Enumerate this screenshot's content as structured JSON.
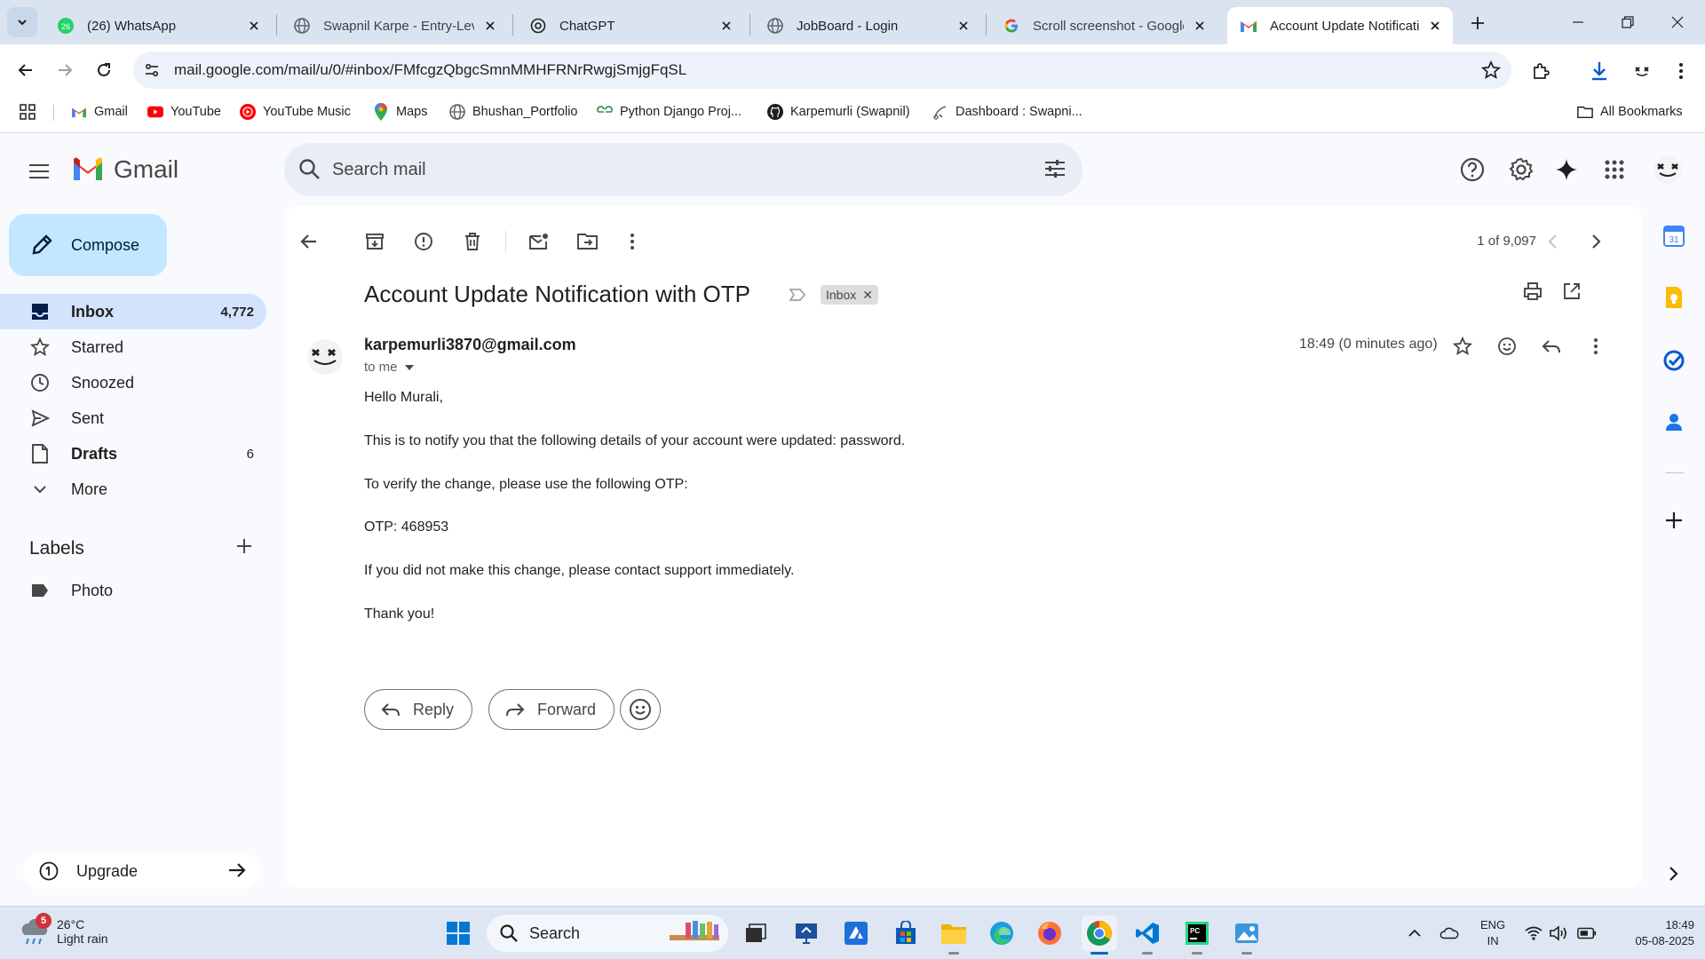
{
  "browser": {
    "tabs": [
      {
        "title": "(26) WhatsApp",
        "icon": "whatsapp-icon",
        "badge": "26"
      },
      {
        "title": "Swapnil Karpe - Entry-Leve",
        "icon": "globe-icon"
      },
      {
        "title": "ChatGPT",
        "icon": "chatgpt-icon"
      },
      {
        "title": "JobBoard - Login",
        "icon": "globe-icon"
      },
      {
        "title": "Scroll screenshot - Google",
        "icon": "google-icon"
      },
      {
        "title": "Account Update Notificati",
        "icon": "gmail-icon",
        "active": true
      }
    ],
    "url": "mail.google.com/mail/u/0/#inbox/FMfcgzQbgcSmnMMHFRNrRwgjSmjgFqSL",
    "bookmarks": [
      {
        "label": "Gmail",
        "icon": "gmail-icon"
      },
      {
        "label": "YouTube",
        "icon": "youtube-icon"
      },
      {
        "label": "YouTube Music",
        "icon": "youtube-music-icon"
      },
      {
        "label": "Maps",
        "icon": "maps-icon"
      },
      {
        "label": "Bhushan_Portfolio",
        "icon": "globe-icon"
      },
      {
        "label": "Python Django Proj...",
        "icon": "gfg-icon"
      },
      {
        "label": "Karpemurli (Swapnil)",
        "icon": "github-icon"
      },
      {
        "label": "Dashboard : Swapni...",
        "icon": "dashboard-icon"
      }
    ],
    "all_bookmarks": "All Bookmarks"
  },
  "gmail": {
    "brand": "Gmail",
    "search_placeholder": "Search mail",
    "compose": "Compose",
    "nav": [
      {
        "label": "Inbox",
        "count": "4,772",
        "icon": "inbox-icon"
      },
      {
        "label": "Starred",
        "count": "",
        "icon": "star-icon"
      },
      {
        "label": "Snoozed",
        "count": "",
        "icon": "clock-icon"
      },
      {
        "label": "Sent",
        "count": "",
        "icon": "send-icon"
      },
      {
        "label": "Drafts",
        "count": "6",
        "icon": "draft-icon"
      },
      {
        "label": "More",
        "count": "",
        "icon": "chevron-down-icon"
      }
    ],
    "labels_title": "Labels",
    "labels": [
      {
        "label": "Photo",
        "icon": "label-icon"
      }
    ],
    "upgrade": "Upgrade",
    "pager": "1 of 9,097",
    "message": {
      "subject": "Account Update Notification with OTP",
      "chip": "Inbox",
      "sender": "karpemurli3870@gmail.com",
      "to": "to me",
      "time": "18:49 (0 minutes ago)",
      "body": [
        "Hello Murali,",
        "This is to notify you that the following details of your account were updated: password.",
        "To verify the change, please use the following OTP:",
        "OTP: 468953",
        "If you did not make this change, please contact support immediately.",
        "Thank you!"
      ],
      "reply": "Reply",
      "forward": "Forward"
    },
    "accent": "#0b57d0"
  },
  "taskbar": {
    "weather_temp": "26°C",
    "weather_cond": "Light rain",
    "weather_badge": "5",
    "search": "Search",
    "lang_line1": "ENG",
    "lang_line2": "IN",
    "time": "18:49",
    "date": "05-08-2025"
  }
}
